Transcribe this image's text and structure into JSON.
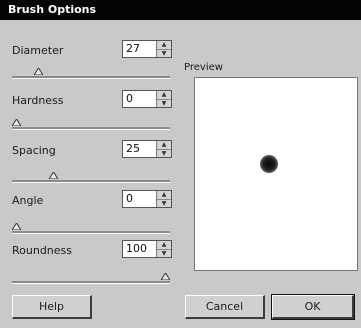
{
  "window": {
    "title": "Brush Options"
  },
  "controls": {
    "diameter": {
      "label": "Diameter",
      "value": "27",
      "slider": 0.15
    },
    "hardness": {
      "label": "Hardness",
      "value": "0",
      "slider": 0.0
    },
    "spacing": {
      "label": "Spacing",
      "value": "25",
      "slider": 0.25
    },
    "angle": {
      "label": "Angle",
      "value": "0",
      "slider": 0.0
    },
    "roundness": {
      "label": "Roundness",
      "value": "100",
      "slider": 1.0
    }
  },
  "preview": {
    "label": "Preview"
  },
  "buttons": {
    "help": "Help",
    "cancel": "Cancel",
    "ok": "OK"
  },
  "icons": {
    "spin_up": "spin-up-icon",
    "spin_down": "spin-down-icon",
    "slider_thumb": "slider-thumb-icon"
  }
}
